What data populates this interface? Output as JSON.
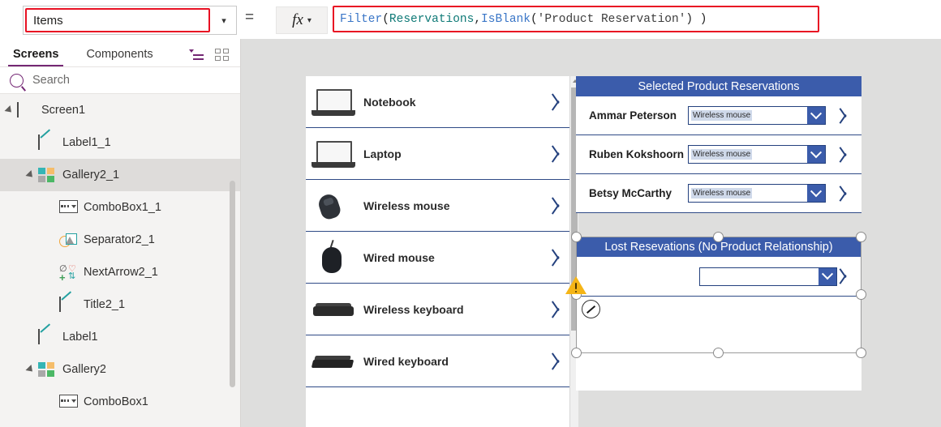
{
  "formula_bar": {
    "property_value": "Items",
    "property_caret": "chevron-down",
    "equals": "=",
    "fx_label": "fx",
    "formula_tokens": [
      {
        "t": "Filter",
        "k": "fn"
      },
      {
        "t": "( ",
        "k": "p"
      },
      {
        "t": "Reservations",
        "k": "tbl"
      },
      {
        "t": ", ",
        "k": "p"
      },
      {
        "t": "IsBlank",
        "k": "fn"
      },
      {
        "t": "( ",
        "k": "p"
      },
      {
        "t": "'Product Reservation'",
        "k": "str"
      },
      {
        "t": " ) )",
        "k": "p"
      }
    ],
    "highlight_color": "#e81123"
  },
  "left_panel": {
    "tabs": [
      {
        "label": "Screens",
        "active": true
      },
      {
        "label": "Components",
        "active": false
      }
    ],
    "view_icons": [
      "tree-view-icon",
      "grid-view-icon"
    ],
    "search": {
      "placeholder": "Search"
    },
    "tree": [
      {
        "label": "Screen1",
        "icon": "screen-icon",
        "indent": 0,
        "expander": true,
        "selected": false
      },
      {
        "label": "Label1_1",
        "icon": "label-icon",
        "indent": 1,
        "expander": false,
        "selected": false
      },
      {
        "label": "Gallery2_1",
        "icon": "gallery-icon",
        "indent": 1,
        "expander": true,
        "selected": true
      },
      {
        "label": "ComboBox1_1",
        "icon": "combobox-icon",
        "indent": 2,
        "expander": false,
        "selected": false
      },
      {
        "label": "Separator2_1",
        "icon": "shapes-icon",
        "indent": 2,
        "expander": false,
        "selected": false
      },
      {
        "label": "NextArrow2_1",
        "icon": "icons-icon",
        "indent": 2,
        "expander": false,
        "selected": false
      },
      {
        "label": "Title2_1",
        "icon": "label-icon",
        "indent": 2,
        "expander": false,
        "selected": false
      },
      {
        "label": "Label1",
        "icon": "label-icon",
        "indent": 1,
        "expander": false,
        "selected": false
      },
      {
        "label": "Gallery2",
        "icon": "gallery-icon",
        "indent": 1,
        "expander": true,
        "selected": false
      },
      {
        "label": "ComboBox1",
        "icon": "combobox-icon",
        "indent": 2,
        "expander": false,
        "selected": false
      }
    ]
  },
  "canvas": {
    "product_gallery": {
      "items": [
        {
          "name": "Notebook",
          "thumb": "laptop-thumb"
        },
        {
          "name": "Laptop",
          "thumb": "laptop-thumb"
        },
        {
          "name": "Wireless mouse",
          "thumb": "wireless-mouse-thumb"
        },
        {
          "name": "Wired mouse",
          "thumb": "wired-mouse-thumb"
        },
        {
          "name": "Wireless keyboard",
          "thumb": "wireless-keyboard-thumb"
        },
        {
          "name": "Wired keyboard",
          "thumb": "wired-keyboard-thumb"
        }
      ]
    },
    "selected_reservations": {
      "title": "Selected Product Reservations",
      "rows": [
        {
          "name": "Ammar Peterson",
          "combo_value": "Wireless mouse"
        },
        {
          "name": "Ruben Kokshoorn",
          "combo_value": "Wireless mouse"
        },
        {
          "name": "Betsy McCarthy",
          "combo_value": "Wireless mouse"
        }
      ]
    },
    "lost_reservations": {
      "title": "Lost Resevations (No Product Relationship)",
      "rows": [
        {
          "name": "",
          "combo_value": ""
        }
      ]
    },
    "warning_icon": "warning-triangle-icon",
    "edit_badge_icon": "pencil-edit-icon",
    "header_color": "#3b5cab",
    "accent_color": "#24417e"
  }
}
